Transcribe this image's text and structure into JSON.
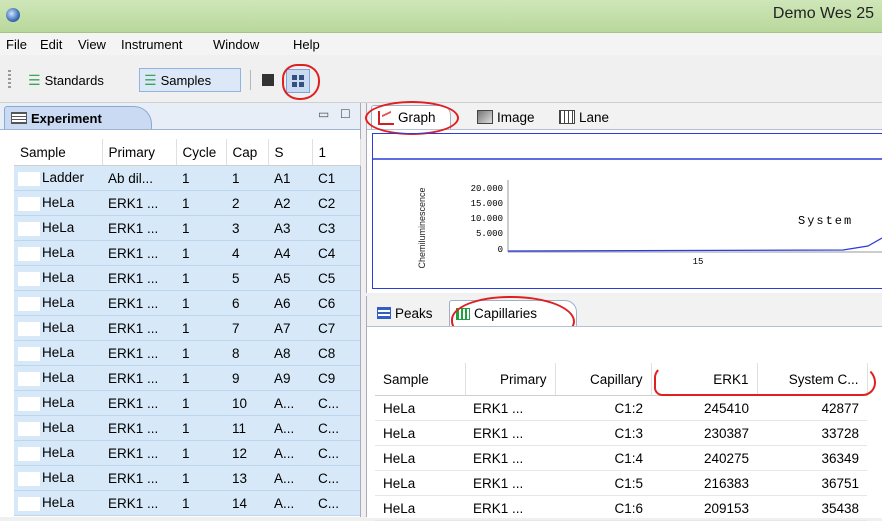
{
  "window": {
    "title": "Demo Wes 25"
  },
  "menu": [
    "File",
    "Edit",
    "View",
    "Instrument",
    "Window",
    "Help"
  ],
  "toolbar": {
    "standards_label": "Standards",
    "samples_label": "Samples"
  },
  "experiment": {
    "tab_label": "Experiment",
    "columns": [
      "Sample",
      "Primary",
      "Cycle",
      "Cap",
      "S",
      "1"
    ],
    "rows": [
      [
        "Ladder",
        "Ab dil...",
        "1",
        "1",
        "A1",
        "C1"
      ],
      [
        "HeLa",
        "ERK1 ...",
        "1",
        "2",
        "A2",
        "C2"
      ],
      [
        "HeLa",
        "ERK1 ...",
        "1",
        "3",
        "A3",
        "C3"
      ],
      [
        "HeLa",
        "ERK1 ...",
        "1",
        "4",
        "A4",
        "C4"
      ],
      [
        "HeLa",
        "ERK1 ...",
        "1",
        "5",
        "A5",
        "C5"
      ],
      [
        "HeLa",
        "ERK1 ...",
        "1",
        "6",
        "A6",
        "C6"
      ],
      [
        "HeLa",
        "ERK1 ...",
        "1",
        "7",
        "A7",
        "C7"
      ],
      [
        "HeLa",
        "ERK1 ...",
        "1",
        "8",
        "A8",
        "C8"
      ],
      [
        "HeLa",
        "ERK1 ...",
        "1",
        "9",
        "A9",
        "C9"
      ],
      [
        "HeLa",
        "ERK1 ...",
        "1",
        "10",
        "A...",
        "C..."
      ],
      [
        "HeLa",
        "ERK1 ...",
        "1",
        "11",
        "A...",
        "C..."
      ],
      [
        "HeLa",
        "ERK1 ...",
        "1",
        "12",
        "A...",
        "C..."
      ],
      [
        "HeLa",
        "ERK1 ...",
        "1",
        "13",
        "A...",
        "C..."
      ],
      [
        "HeLa",
        "ERK1 ...",
        "1",
        "14",
        "A...",
        "C..."
      ]
    ]
  },
  "graph_tabs": [
    "Graph",
    "Image",
    "Lane"
  ],
  "graph": {
    "ylabel": "Chemiluminescence",
    "y_ticks": [
      "20.000",
      "15.000",
      "10.000",
      "5.000",
      "0"
    ],
    "x_tick": "15",
    "annotation": "System"
  },
  "lower_tabs": [
    "Peaks",
    "Capillaries"
  ],
  "capillaries": {
    "columns": [
      "Sample",
      "Primary",
      "Capillary",
      "ERK1",
      "System C..."
    ],
    "rows": [
      [
        "HeLa",
        "ERK1 ...",
        "C1:2",
        "245410",
        "42877"
      ],
      [
        "HeLa",
        "ERK1 ...",
        "C1:3",
        "230387",
        "33728"
      ],
      [
        "HeLa",
        "ERK1 ...",
        "C1:4",
        "240275",
        "36349"
      ],
      [
        "HeLa",
        "ERK1 ...",
        "C1:5",
        "216383",
        "36751"
      ],
      [
        "HeLa",
        "ERK1 ...",
        "C1:6",
        "209153",
        "35438"
      ]
    ]
  },
  "colors": {
    "title_bar": "#c2dfa6",
    "selection_row": "#d7e9f8",
    "annotation": "#e02020",
    "plot_line": "#2b3bdc"
  }
}
